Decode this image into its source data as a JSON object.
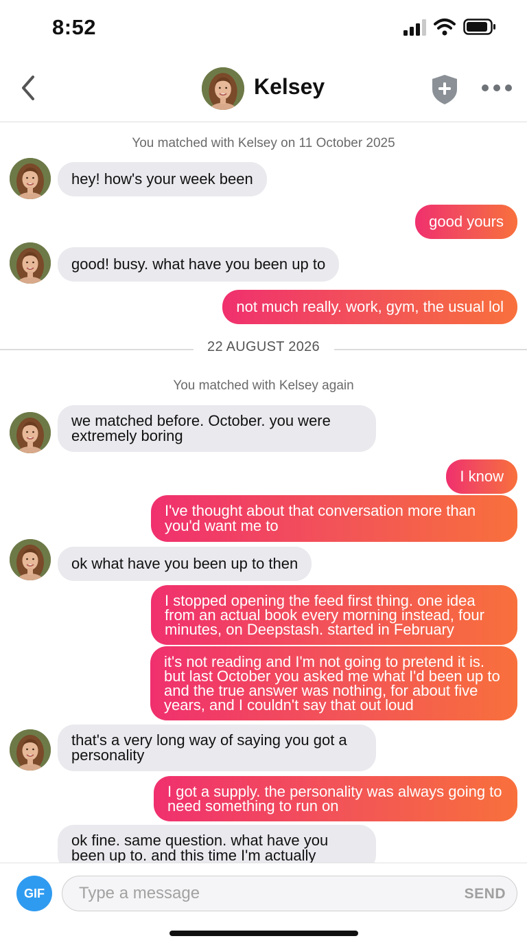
{
  "status_bar": {
    "time": "8:52"
  },
  "header": {
    "contact_name": "Kelsey"
  },
  "chat": {
    "match_note_1": "You matched with Kelsey on 11 October 2025",
    "date_separator": "22 AUGUST 2026",
    "match_note_2": "You matched with Kelsey again",
    "messages": [
      {
        "from": "them",
        "text": "hey! how's your week been"
      },
      {
        "from": "me",
        "text": "good yours"
      },
      {
        "from": "them",
        "text": "good! busy. what have you been up to"
      },
      {
        "from": "me",
        "text": "not much really. work, gym, the usual lol"
      },
      {
        "from": "them",
        "text": "we matched before. October. you were extremely boring"
      },
      {
        "from": "me",
        "text": "I know"
      },
      {
        "from": "me",
        "text": "I've thought about that conversation more than you'd want me to"
      },
      {
        "from": "them",
        "text": "ok what have you been up to then"
      },
      {
        "from": "me",
        "text": "I stopped opening the feed first thing. one idea from an actual book every morning instead, four minutes, on Deepstash. started in February"
      },
      {
        "from": "me",
        "text": "it's not reading and I'm not going to pretend it is. but last October you asked me what I'd been up to and the true answer was nothing, for about five years, and I couldn't say that out loud"
      },
      {
        "from": "them",
        "text": "that's a very long way of saying you got a personality"
      },
      {
        "from": "me",
        "text": "I got a supply. the personality was always going to need something to run on"
      },
      {
        "from": "them",
        "text": "ok fine. same question. what have you been up to. and this time I'm actually"
      }
    ]
  },
  "composer": {
    "gif_label": "GIF",
    "placeholder": "Type a message",
    "send_label": "SEND"
  },
  "colors": {
    "outgoing_gradient_start": "#f0306e",
    "outgoing_gradient_end": "#f8703c",
    "incoming_bubble": "#e9e9ee",
    "gif_button": "#2f9bf0"
  },
  "icons": {
    "back": "chevron-left-icon",
    "safety": "shield-plus-icon",
    "more": "more-dots-icon",
    "signal": "cellular-signal-icon",
    "wifi": "wifi-icon",
    "battery": "battery-icon"
  }
}
